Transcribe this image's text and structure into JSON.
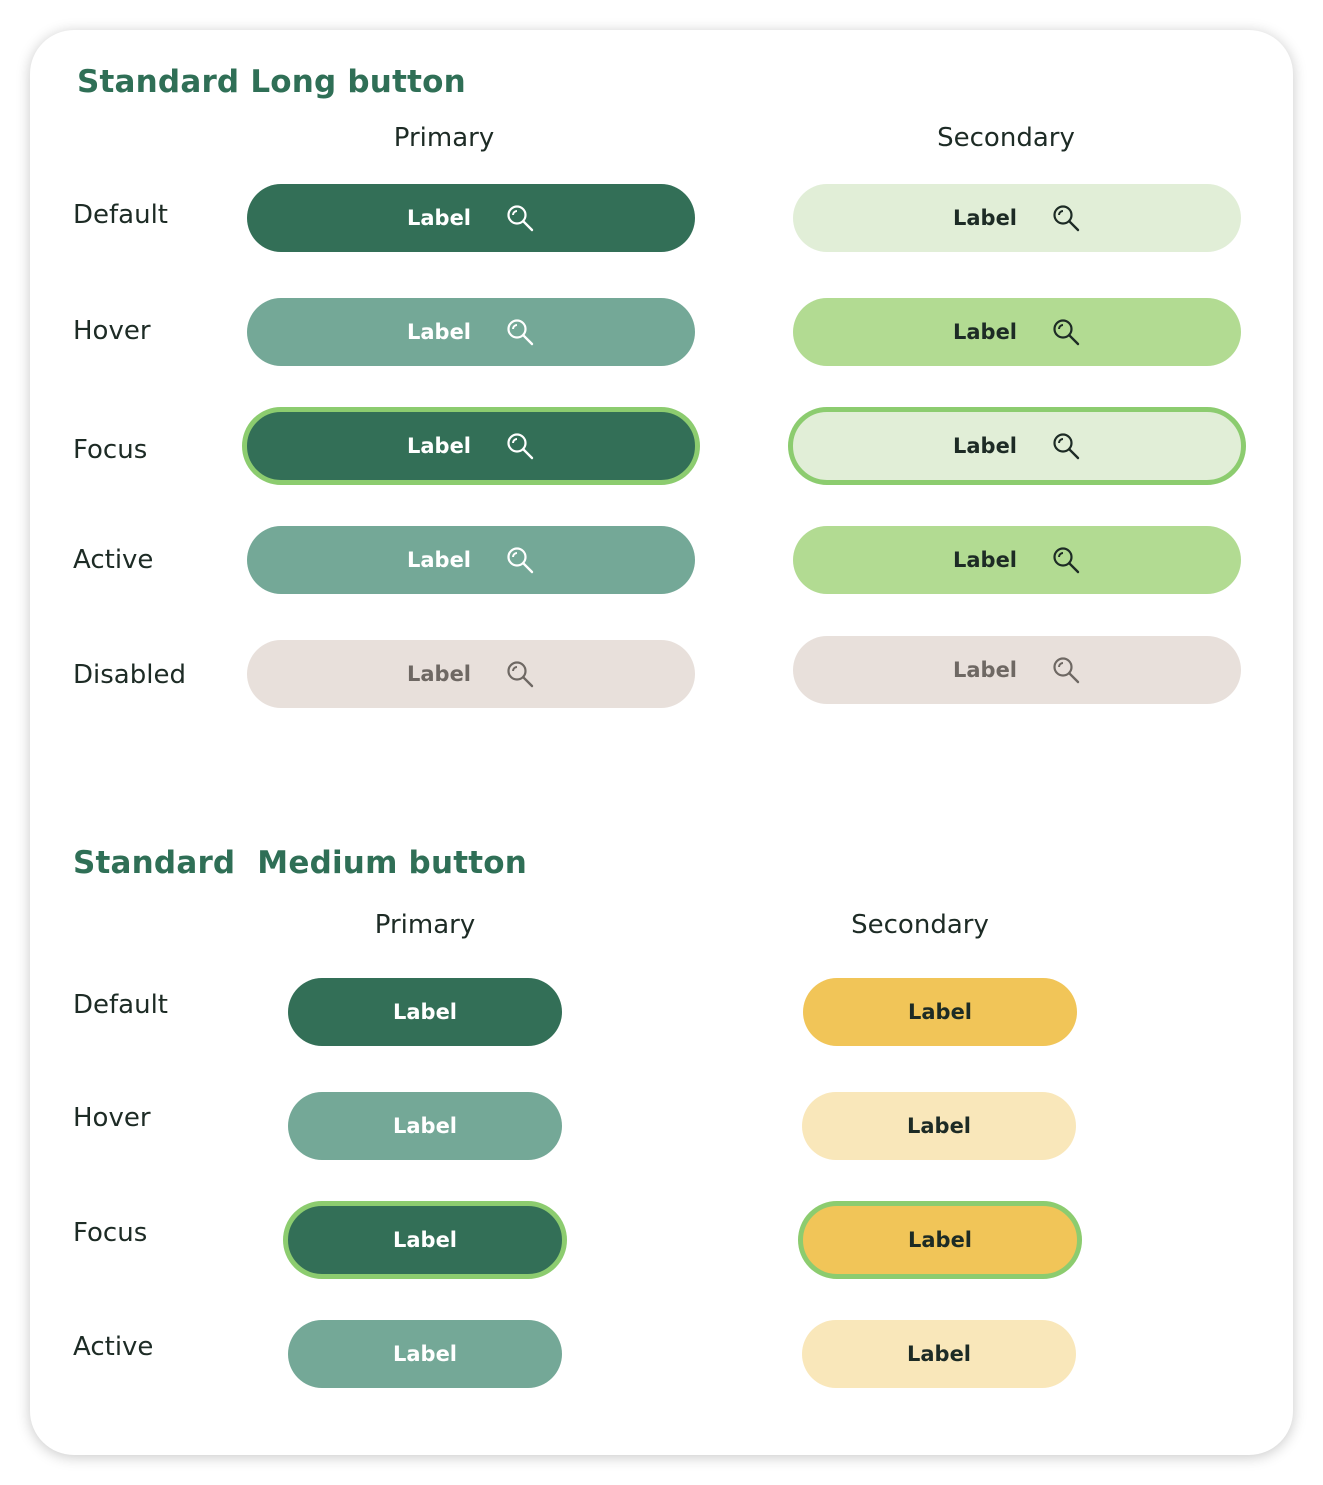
{
  "colors": {
    "title_green": "#2f6f56",
    "primary_default": "#336f57",
    "primary_hover": "#74a897",
    "secondary_default": "#e1eed7",
    "secondary_hover": "#b2db92",
    "disabled_bg": "#e8e0db",
    "disabled_text": "#6e6863",
    "focus_ring": "#8ccc6f",
    "medium_secondary_default": "#f1c558",
    "medium_secondary_hover": "#f9e7ba"
  },
  "long_section": {
    "title": "Standard Long button",
    "primary_heading": "Primary",
    "secondary_heading": "Secondary",
    "states": [
      "Default",
      "Hover",
      "Focus",
      "Active",
      "Disabled"
    ],
    "button_label": "Label",
    "icon": "search-icon"
  },
  "medium_section": {
    "title": "Standard  Medium button",
    "primary_heading": "Primary",
    "secondary_heading": "Secondary",
    "states": [
      "Default",
      "Hover",
      "Focus",
      "Active"
    ],
    "button_label": "Label"
  }
}
